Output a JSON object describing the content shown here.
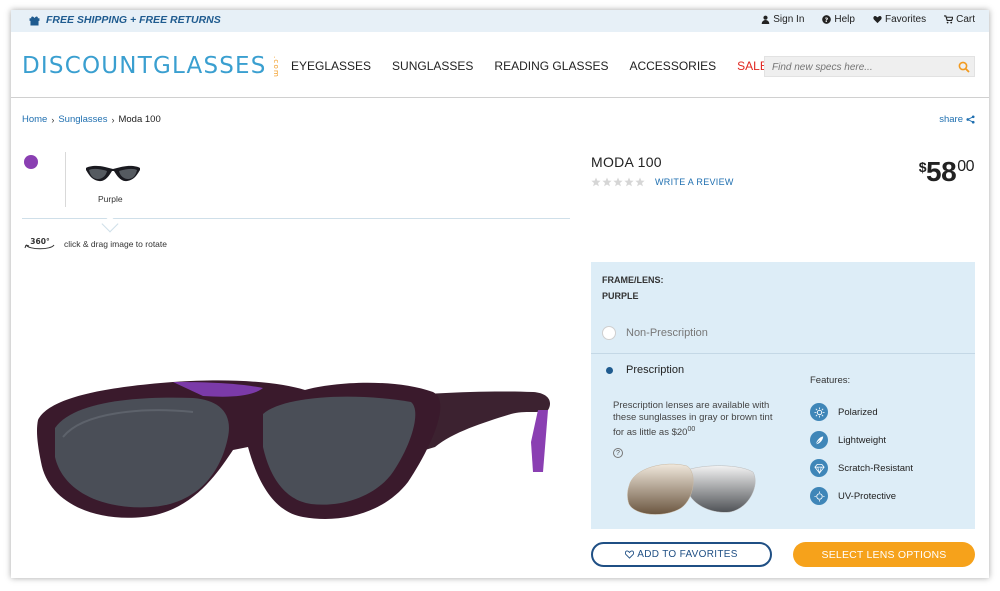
{
  "utility_bar": {
    "shipping_text": "FREE SHIPPING + FREE RETURNS",
    "links": [
      {
        "label": "Sign In",
        "icon": "user-icon"
      },
      {
        "label": "Help",
        "icon": "help-icon"
      },
      {
        "label": "Favorites",
        "icon": "heart-icon"
      },
      {
        "label": "Cart",
        "icon": "cart-icon"
      }
    ]
  },
  "header": {
    "logo_text": "DISCOUNTGLASSES",
    "logo_suffix": ".com",
    "nav": [
      "EYEGLASSES",
      "SUNGLASSES",
      "READING GLASSES",
      "ACCESSORIES",
      "SALE"
    ],
    "search_placeholder": "Find new specs here..."
  },
  "breadcrumb": {
    "items": [
      "Home",
      "Sunglasses",
      "Moda 100"
    ],
    "share_label": "share"
  },
  "gallery": {
    "color_name": "Purple",
    "rotate_badge": "360°",
    "rotate_hint": "click & drag image to rotate"
  },
  "product": {
    "name": "MODA 100",
    "write_review": "WRITE A REVIEW",
    "rating_stars": 0,
    "price_currency": "$",
    "price_dollars": "58",
    "price_cents": "00"
  },
  "options": {
    "frame_lens_label": "FRAME/LENS:",
    "frame_lens_value": "PURPLE",
    "non_rx_label": "Non-Prescription",
    "rx_label": "Prescription",
    "selected": "Prescription",
    "rx_info": "Prescription lenses are available with these sunglasses in gray or brown tint for as little as ",
    "rx_price": "$20",
    "rx_price_cents": "00",
    "help_icon": "?",
    "features_title": "Features:",
    "features": [
      {
        "label": "Polarized",
        "icon": "sun-icon"
      },
      {
        "label": "Lightweight",
        "icon": "feather-icon"
      },
      {
        "label": "Scratch-Resistant",
        "icon": "diamond-icon"
      },
      {
        "label": "UV-Protective",
        "icon": "uv-icon"
      }
    ]
  },
  "actions": {
    "favorite_label": "ADD TO FAVORITES",
    "select_label": "SELECT LENS OPTIONS"
  },
  "colors": {
    "brand_blue": "#3a9fd0",
    "link_blue": "#1f6fb0",
    "accent_orange": "#f6a21b",
    "sale_red": "#e0261f",
    "swatch_purple": "#8a3fb2",
    "panel_bg": "#ddedf7"
  }
}
